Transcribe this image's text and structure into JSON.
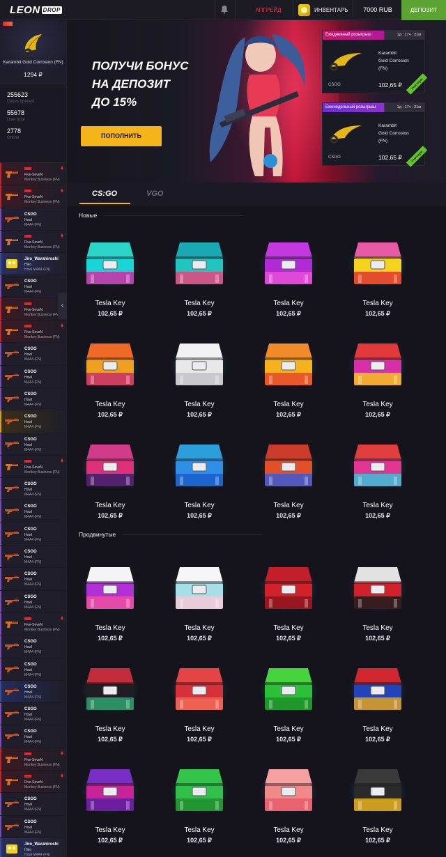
{
  "header": {
    "logo_main": "LEON",
    "logo_badge": "DROP",
    "upgrade": "АПГРЕЙД",
    "inventory": "ИНВЕНТАРЬ",
    "balance": "7000 RUB",
    "deposit": "ДЕПОЗИТ"
  },
  "sidebar": {
    "featured": {
      "name": "Karambit Gold Corrosion (FN)",
      "price": "1294 ₽"
    },
    "stats": [
      {
        "value": "255623",
        "label": "Cases opened"
      },
      {
        "value": "55678",
        "label": "User total"
      },
      {
        "value": "2778",
        "label": "Online"
      }
    ],
    "drops": [
      {
        "kind": "fiveseven",
        "label_top": "",
        "label_sub": "Five-SeveN",
        "label_sub2": "Monkey Business (FN)",
        "accent": "#c9232d",
        "bg": "#3a1a24"
      },
      {
        "kind": "fiveseven",
        "label_top": "",
        "label_sub": "Five-SeveN",
        "label_sub2": "Monkey Business (FN)",
        "accent": "#c9232d",
        "bg": "#3a1a24"
      },
      {
        "kind": "m4",
        "label_top": "CSGO",
        "label_sub": "Howl",
        "label_sub2": "M4A4 (FN)",
        "accent": "#7e48c6",
        "bg": "#241f34"
      },
      {
        "kind": "fiveseven",
        "label_top": "",
        "label_sub": "Five-SeveN",
        "label_sub2": "Monkey Business (FN)",
        "accent": "#7e48c6",
        "bg": "#241f34"
      },
      {
        "kind": "sponge",
        "label_top": "Jiro_Warahiroshi",
        "label_sub": "Hiko",
        "label_sub2": "Howl M4A4 (FN)",
        "accent": "#3a4a9c",
        "bg": "#2a3060"
      },
      {
        "kind": "m4",
        "label_top": "CSGO",
        "label_sub": "Howl",
        "label_sub2": "M4A4 (FN)",
        "accent": "#7e48c6",
        "bg": "#211e2c"
      },
      {
        "kind": "fiveseven",
        "label_top": "",
        "label_sub": "Five-SeveN",
        "label_sub2": "Monkey Business (FN)",
        "accent": "#c9232d",
        "bg": "#3a1a24"
      },
      {
        "kind": "fiveseven",
        "label_top": "",
        "label_sub": "Five-SeveN",
        "label_sub2": "Monkey Business (FN)",
        "accent": "#c9232d",
        "bg": "#3a1a24"
      },
      {
        "kind": "m4",
        "label_top": "CSGO",
        "label_sub": "Howl",
        "label_sub2": "M4A4 (FN)",
        "accent": "#7e48c6",
        "bg": "#211e2c"
      },
      {
        "kind": "m4",
        "label_top": "CSGO",
        "label_sub": "Howl",
        "label_sub2": "M4A4 (FN)",
        "accent": "#7e48c6",
        "bg": "#211e2c"
      },
      {
        "kind": "m4",
        "label_top": "CSGO",
        "label_sub": "Howl",
        "label_sub2": "M4A4 (FN)",
        "accent": "#7e48c6",
        "bg": "#211e2c"
      },
      {
        "kind": "m4",
        "label_top": "CSGO",
        "label_sub": "Howl",
        "label_sub2": "M4A4 (FN)",
        "accent": "#d4a11c",
        "bg": "#3a2f18"
      },
      {
        "kind": "m4",
        "label_top": "CSGO",
        "label_sub": "Howl",
        "label_sub2": "M4A4 (FN)",
        "accent": "#7e48c6",
        "bg": "#211e2c"
      },
      {
        "kind": "fiveseven",
        "label_top": "",
        "label_sub": "Five-SeveN",
        "label_sub2": "Monkey Business (FN)",
        "accent": "#7e48c6",
        "bg": "#211e2c"
      },
      {
        "kind": "m4",
        "label_top": "CSGO",
        "label_sub": "Howl",
        "label_sub2": "M4A4 (FN)",
        "accent": "#7e48c6",
        "bg": "#211e2c"
      },
      {
        "kind": "m4",
        "label_top": "CSGO",
        "label_sub": "Howl",
        "label_sub2": "M4A4 (FN)",
        "accent": "#7e48c6",
        "bg": "#211e2c"
      },
      {
        "kind": "m4",
        "label_top": "CSGO",
        "label_sub": "Howl",
        "label_sub2": "M4A4 (FN)",
        "accent": "#7e48c6",
        "bg": "#211e2c"
      },
      {
        "kind": "m4",
        "label_top": "CSGO",
        "label_sub": "Howl",
        "label_sub2": "M4A4 (FN)",
        "accent": "#7e48c6",
        "bg": "#211e2c"
      },
      {
        "kind": "m4",
        "label_top": "CSGO",
        "label_sub": "Howl",
        "label_sub2": "M4A4 (FN)",
        "accent": "#7e48c6",
        "bg": "#211e2c"
      },
      {
        "kind": "m4",
        "label_top": "CSGO",
        "label_sub": "Howl",
        "label_sub2": "M4A4 (FN)",
        "accent": "#7e48c6",
        "bg": "#211e2c"
      },
      {
        "kind": "fiveseven",
        "label_top": "",
        "label_sub": "Five-SeveN",
        "label_sub2": "Monkey Business (FN)",
        "accent": "#7e48c6",
        "bg": "#211e2c"
      },
      {
        "kind": "m4",
        "label_top": "CSGO",
        "label_sub": "Howl",
        "label_sub2": "M4A4 (FN)",
        "accent": "#7e48c6",
        "bg": "#211e2c"
      },
      {
        "kind": "m4",
        "label_top": "CSGO",
        "label_sub": "Howl",
        "label_sub2": "M4A4 (FN)",
        "accent": "#7e48c6",
        "bg": "#211e2c"
      },
      {
        "kind": "m4",
        "label_top": "CSGO",
        "label_sub": "Howl",
        "label_sub2": "M4A4 (FN)",
        "accent": "#3a4a9c",
        "bg": "#242c5a"
      },
      {
        "kind": "m4",
        "label_top": "CSGO",
        "label_sub": "Howl",
        "label_sub2": "M4A4 (FN)",
        "accent": "#7e48c6",
        "bg": "#211e2c"
      },
      {
        "kind": "m4",
        "label_top": "CSGO",
        "label_sub": "Howl",
        "label_sub2": "M4A4 (FN)",
        "accent": "#7e48c6",
        "bg": "#211e2c"
      },
      {
        "kind": "fiveseven",
        "label_top": "",
        "label_sub": "Five-SeveN",
        "label_sub2": "Monkey Business (FN)",
        "accent": "#c9232d",
        "bg": "#3a1a24"
      },
      {
        "kind": "fiveseven",
        "label_top": "",
        "label_sub": "Five-SeveN",
        "label_sub2": "Monkey Business (FN)",
        "accent": "#c9232d",
        "bg": "#3a1a24"
      },
      {
        "kind": "m4",
        "label_top": "CSGO",
        "label_sub": "Howl",
        "label_sub2": "M4A4 (FN)",
        "accent": "#7e48c6",
        "bg": "#211e2c"
      },
      {
        "kind": "m4",
        "label_top": "CSGO",
        "label_sub": "Howl",
        "label_sub2": "M4A4 (FN)",
        "accent": "#7e48c6",
        "bg": "#211e2c"
      },
      {
        "kind": "sponge",
        "label_top": "Jiro_Warahiroshi",
        "label_sub": "Hiko",
        "label_sub2": "Howl M4A4 (FN)",
        "accent": "#3a4a9c",
        "bg": "#2a3060"
      }
    ]
  },
  "banner": {
    "headline": [
      "ПОЛУЧИ БОНУС",
      "НА ДЕПОЗИТ",
      "ДО 15%"
    ],
    "button": "ПОПОЛНИТЬ",
    "raffles": [
      {
        "title": "Ежедневный розыгрыш",
        "timer": "1д : 17ч : 21м",
        "item": [
          "Karambit",
          "Gold Corrosion",
          "(FN)"
        ],
        "game": "CSGO",
        "price": "102,65 ₽",
        "tag": "Участвую"
      },
      {
        "title": "Еженедельный розыгрыш",
        "timer": "1д : 17ч : 21м",
        "item": [
          "Karambit",
          "Gold Corrosion",
          "(FN)"
        ],
        "game": "CSGO",
        "price": "102,65 ₽",
        "tag": "Участвую"
      }
    ]
  },
  "games": {
    "tabs": [
      "CS:GO",
      "VGO"
    ],
    "active": "CS:GO"
  },
  "sections": [
    {
      "title": "Новые",
      "cases": [
        {
          "name": "Tesla Key",
          "price": "102,65 ₽",
          "c1": "#19d6d6",
          "c2": "#d12ba6",
          "lid": "#2ad4c8"
        },
        {
          "name": "Tesla Key",
          "price": "102,65 ₽",
          "c1": "#22c4c0",
          "c2": "#e7447a",
          "lid": "#1aa8b2"
        },
        {
          "name": "Tesla Key",
          "price": "102,65 ₽",
          "c1": "#b02bd6",
          "c2": "#e84fd8",
          "lid": "#c438e0"
        },
        {
          "name": "Tesla Key",
          "price": "102,65 ₽",
          "c1": "#f4d21d",
          "c2": "#e1352f",
          "lid": "#e65aa6"
        },
        {
          "name": "Tesla Key",
          "price": "102,65 ₽",
          "c1": "#f0a020",
          "c2": "#c52e6c",
          "lid": "#ef6a27"
        },
        {
          "name": "Tesla Key",
          "price": "102,65 ₽",
          "c1": "#e8e8ea",
          "c2": "#c3c3c8",
          "lid": "#f2f2f4"
        },
        {
          "name": "Tesla Key",
          "price": "102,65 ₽",
          "c1": "#f5b21c",
          "c2": "#e5482b",
          "lid": "#f18b2a"
        },
        {
          "name": "Tesla Key",
          "price": "102,65 ₽",
          "c1": "#d72fa7",
          "c2": "#f4c21d",
          "lid": "#e23a3a"
        },
        {
          "name": "Tesla Key",
          "price": "102,65 ₽",
          "c1": "#e0307a",
          "c2": "#3b1f6c",
          "lid": "#d13b8a"
        },
        {
          "name": "Tesla Key",
          "price": "102,65 ₽",
          "c1": "#2f8fe6",
          "c2": "#1a5ec9",
          "lid": "#2a9fdc"
        },
        {
          "name": "Tesla Key",
          "price": "102,65 ₽",
          "c1": "#e24f29",
          "c2": "#3a5ad6",
          "lid": "#cd3b2b"
        },
        {
          "name": "Tesla Key",
          "price": "102,65 ₽",
          "c1": "#e23592",
          "c2": "#3ac0d8",
          "lid": "#e13d3d"
        }
      ]
    },
    {
      "title": "Продвинутые",
      "cases": [
        {
          "name": "Tesla Key",
          "price": "102,65 ₽",
          "c1": "#b12fd6",
          "c2": "#f04fa0",
          "lid": "#f4f4f6"
        },
        {
          "name": "Tesla Key",
          "price": "102,65 ₽",
          "c1": "#a7dfe8",
          "c2": "#f3c9d6",
          "lid": "#f6f6f8"
        },
        {
          "name": "Tesla Key",
          "price": "102,65 ₽",
          "c1": "#d1222c",
          "c2": "#8d141d",
          "lid": "#c21f2a"
        },
        {
          "name": "Tesla Key",
          "price": "102,65 ₽",
          "c1": "#d1222c",
          "c2": "#1c1c1c",
          "lid": "#e2e2e2"
        },
        {
          "name": "Tesla Key",
          "price": "102,65 ₽",
          "c1": "#1e1e24",
          "c2": "#2fa36f",
          "lid": "#c32c3a"
        },
        {
          "name": "Tesla Key",
          "price": "102,65 ₽",
          "c1": "#d7303a",
          "c2": "#f06a55",
          "lid": "#e44444"
        },
        {
          "name": "Tesla Key",
          "price": "102,65 ₽",
          "c1": "#2bbf3a",
          "c2": "#1f8f28",
          "lid": "#45d43d"
        },
        {
          "name": "Tesla Key",
          "price": "102,65 ₽",
          "c1": "#2543b8",
          "c2": "#e0a21d",
          "lid": "#d0262f"
        },
        {
          "name": "Tesla Key",
          "price": "102,65 ₽",
          "c1": "#c9239a",
          "c2": "#5a1fa0",
          "lid": "#7a2fc4"
        },
        {
          "name": "Tesla Key",
          "price": "102,65 ₽",
          "c1": "#2fbf4a",
          "c2": "#1f8f2d",
          "lid": "#34c44a"
        },
        {
          "name": "Tesla Key",
          "price": "102,65 ₽",
          "c1": "#f08a8a",
          "c2": "#e85a6a",
          "lid": "#f5a0a0"
        },
        {
          "name": "Tesla Key",
          "price": "102,65 ₽",
          "c1": "#2a2a2a",
          "c2": "#e6b21d",
          "lid": "#3a3a3a"
        }
      ]
    }
  ]
}
